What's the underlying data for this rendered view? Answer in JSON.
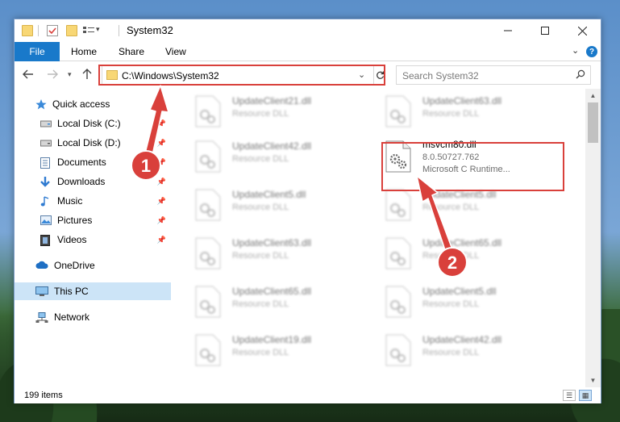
{
  "window": {
    "title": "System32"
  },
  "ribbon": {
    "tabs": [
      "File",
      "Home",
      "Share",
      "View"
    ]
  },
  "navigation": {
    "address": "C:\\Windows\\System32",
    "search_placeholder": "Search System32"
  },
  "sidebar": {
    "items": [
      {
        "label": "Quick access",
        "icon": "star-icon",
        "pinned": false
      },
      {
        "label": "Local Disk (C:)",
        "icon": "drive-icon",
        "pinned": true
      },
      {
        "label": "Local Disk (D:)",
        "icon": "drive-icon",
        "pinned": true
      },
      {
        "label": "Documents",
        "icon": "documents-icon",
        "pinned": true
      },
      {
        "label": "Downloads",
        "icon": "download-icon",
        "pinned": true
      },
      {
        "label": "Music",
        "icon": "music-icon",
        "pinned": true
      },
      {
        "label": "Pictures",
        "icon": "pictures-icon",
        "pinned": true
      },
      {
        "label": "Videos",
        "icon": "videos-icon",
        "pinned": true
      },
      {
        "label": "OneDrive",
        "icon": "onedrive-icon",
        "pinned": false
      },
      {
        "label": "This PC",
        "icon": "computer-icon",
        "pinned": false,
        "selected": true
      },
      {
        "label": "Network",
        "icon": "network-icon",
        "pinned": false
      }
    ]
  },
  "files": {
    "left": [
      {
        "name": "UpdateClient21.dll",
        "type": "Resource DLL"
      },
      {
        "name": "UpdateClient42.dll",
        "type": "Resource DLL"
      },
      {
        "name": "UpdateClient5.dll",
        "type": "Resource DLL"
      },
      {
        "name": "UpdateClient63.dll",
        "type": "Resource DLL"
      },
      {
        "name": "UpdateClient65.dll",
        "type": "Resource DLL"
      },
      {
        "name": "UpdateClient19.dll",
        "type": "Resource DLL"
      }
    ],
    "right": [
      {
        "name": "UpdateClient63.dll",
        "type": "Resource DLL"
      },
      {
        "name": "UpdateClient5.dll",
        "type": "Resource DLL"
      },
      {
        "name": "UpdateClient65.dll",
        "type": "Resource DLL"
      },
      {
        "name": "UpdateClient5.dll",
        "type": "Resource DLL"
      },
      {
        "name": "UpdateClient42.dll",
        "type": "Resource DLL"
      }
    ],
    "highlighted": {
      "name": "msvcm80.dll",
      "version": "8.0.50727.762",
      "description": "Microsoft C Runtime..."
    }
  },
  "status": {
    "item_count": "199 items"
  },
  "annotations": {
    "badge_1": "1",
    "badge_2": "2",
    "color": "#d9403b"
  }
}
